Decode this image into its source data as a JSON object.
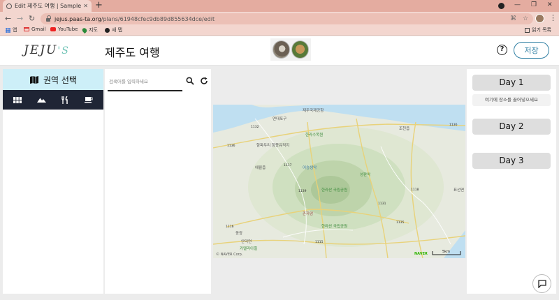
{
  "browser": {
    "tab_title": "Edit 제주도 여행 | Sample",
    "url_host": "jejus.paas-ta.org",
    "url_path": "/plans/61948cfec9db89d855634dce/edit",
    "bookmarks": [
      "앱",
      "Gmail",
      "YouTube",
      "지도",
      "새 탭"
    ],
    "reading_list": "읽기 목록"
  },
  "header": {
    "logo_main": "JEJU",
    "logo_accent": "'S",
    "title": "제주도 여행",
    "help_icon": "help-circle-icon",
    "save_label": "저장"
  },
  "region": {
    "title": "권역 선택",
    "icon": "map-icon",
    "categories": [
      "grid-icon",
      "mountain-icon",
      "utensils-icon",
      "coffee-icon"
    ]
  },
  "search": {
    "placeholder": "검색어를 입력하세요",
    "search_icon": "search-icon",
    "refresh_icon": "refresh-icon"
  },
  "map": {
    "places": [
      "제주국제공항",
      "연대포구",
      "한라수목원",
      "항파두리 항몽유적지",
      "애월읍",
      "어승생악",
      "조천읍",
      "한라산 국립공원",
      "성판악",
      "표선면",
      "안덕면",
      "존자암",
      "한라산 국립공원",
      "카멜리아힐",
      "동광"
    ],
    "roads": [
      "1136",
      "1132",
      "1117",
      "1139",
      "1131",
      "1118",
      "1115",
      "1116",
      "1135",
      "1136"
    ],
    "attribution": "© NAVER Corp.",
    "scale": "5km",
    "brand": "NAVER"
  },
  "days": {
    "labels": [
      "Day 1",
      "Day 2",
      "Day 3"
    ],
    "drop_hint": "여기에 장소를 끌어넣으세요"
  },
  "colors": {
    "save_accent": "#2f7fa3",
    "region_header_bg": "#cdeff8",
    "category_bar_bg": "#1f2535"
  }
}
